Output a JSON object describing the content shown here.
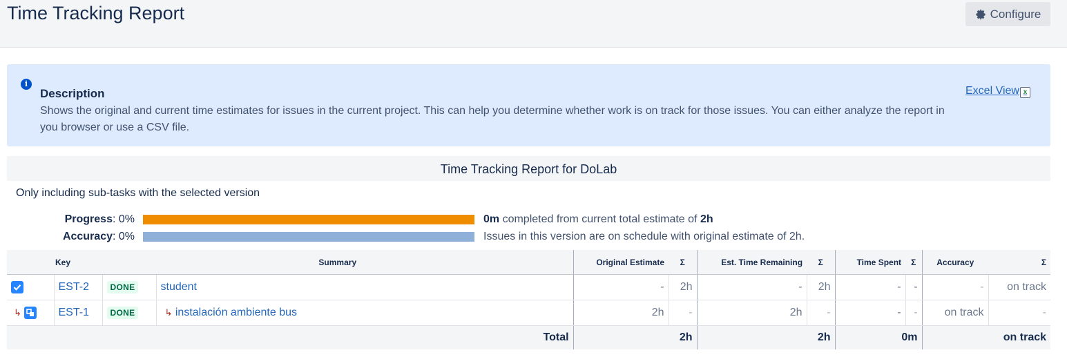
{
  "header": {
    "title": "Time Tracking Report",
    "configure_label": "Configure"
  },
  "description": {
    "title": "Description",
    "text": "Shows the original and current time estimates for issues in the current project. This can help you determine whether work is on track for those issues. You can either analyze the report in you browser or use a CSV file.",
    "excel_link": "Excel View",
    "excel_icon_letter": "x"
  },
  "report": {
    "heading": "Time Tracking Report for DoLab",
    "subtitle": "Only including sub-tasks with the selected version",
    "progress": {
      "label": "Progress",
      "value": "0%",
      "completed": "0m",
      "text_mid": "completed from current total estimate of",
      "total": "2h",
      "bar_fill_fraction": 1.0,
      "bar_color": "#f08c00"
    },
    "accuracy": {
      "label": "Accuracy",
      "value": "0%",
      "text": "Issues in this version are on schedule with original estimate of 2h.",
      "bar_fill_fraction": 1.0,
      "bar_color": "#8fb0d9"
    }
  },
  "table": {
    "headers": {
      "key": "Key",
      "summary": "Summary",
      "original_estimate": "Original Estimate",
      "est_time_remaining": "Est. Time Remaining",
      "time_spent": "Time Spent",
      "accuracy": "Accuracy",
      "sigma": "Σ"
    },
    "rows": [
      {
        "icon": "checkbox-icon",
        "key": "EST-2",
        "status": "DONE",
        "summary": "student",
        "original_estimate": "-",
        "original_estimate_sum": "2h",
        "est_remaining": "-",
        "est_remaining_sum": "2h",
        "time_spent": "-",
        "time_spent_sum": "-",
        "accuracy": "-",
        "accuracy_sum": "on track"
      },
      {
        "icon": "subtask-icon",
        "key": "EST-1",
        "status": "DONE",
        "summary": "instalación ambiente bus",
        "original_estimate": "2h",
        "original_estimate_sum": "-",
        "est_remaining": "2h",
        "est_remaining_sum": "-",
        "time_spent": "-",
        "time_spent_sum": "-",
        "accuracy": "on track",
        "accuracy_sum": "-"
      }
    ],
    "total": {
      "label": "Total",
      "original_estimate": "2h",
      "est_remaining": "2h",
      "time_spent": "0m",
      "accuracy": "on track"
    }
  },
  "colors": {
    "link": "#2466b8",
    "info_bg": "#deebff",
    "done_lozenge_bg": "#e3fcef",
    "done_lozenge_text": "#006644"
  }
}
